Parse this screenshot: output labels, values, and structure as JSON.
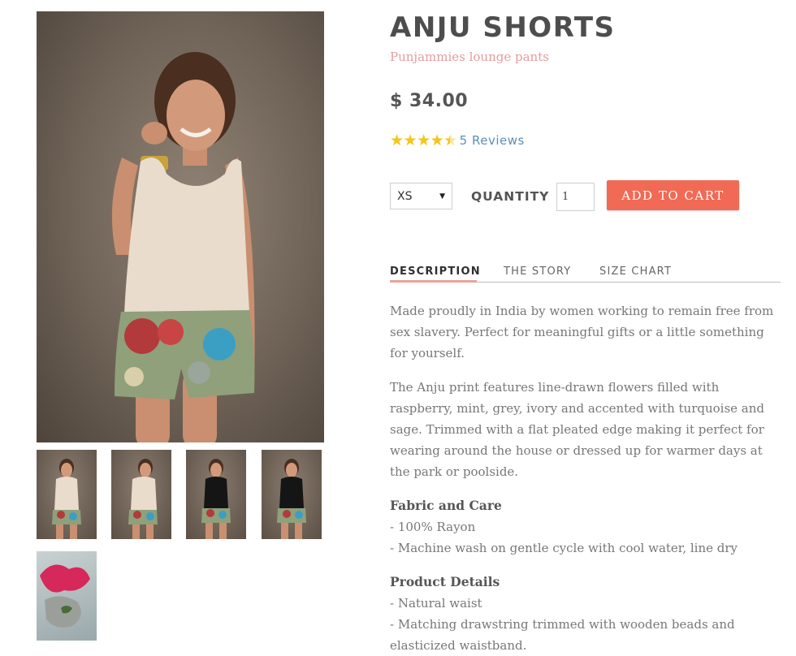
{
  "product": {
    "title": "ANJU SHORTS",
    "subtitle": "Punjammies lounge pants",
    "price": "$ 34.00",
    "rating": {
      "value": 4.5,
      "out_of": 5,
      "reviews_label": "5 Reviews"
    }
  },
  "purchase": {
    "size_selected": "XS",
    "quantity_label": "QUANTITY",
    "quantity_value": "1",
    "add_to_cart_label": "ADD TO CART"
  },
  "tabs": [
    {
      "label": "DESCRIPTION",
      "active": true
    },
    {
      "label": "THE STORY",
      "active": false
    },
    {
      "label": "SIZE CHART",
      "active": false
    }
  ],
  "description": {
    "paragraphs": [
      "Made proudly in India by women working to remain free from sex slavery. Perfect for meaningful gifts or a little something for yourself.",
      "The Anju print features line-drawn flowers filled with raspberry, mint, grey, ivory and accented with turquoise and sage. Trimmed with a flat pleated edge making it perfect for wearing around the house or dressed up for warmer days at the park or poolside."
    ],
    "fabric_heading": "Fabric and Care",
    "fabric_items": [
      "- 100% Rayon",
      "- Machine wash on gentle cycle with cool water, line dry"
    ],
    "details_heading": "Product Details",
    "details_items": [
      "- Natural waist",
      "- Matching drawstring trimmed with wooden beads and elasticized waistband."
    ]
  },
  "colors": {
    "accent": "#f16a55",
    "subtitle": "#e59c9c",
    "star": "#f5c518",
    "link": "#5b8fb9",
    "tab_underline": "#e8a39a"
  }
}
